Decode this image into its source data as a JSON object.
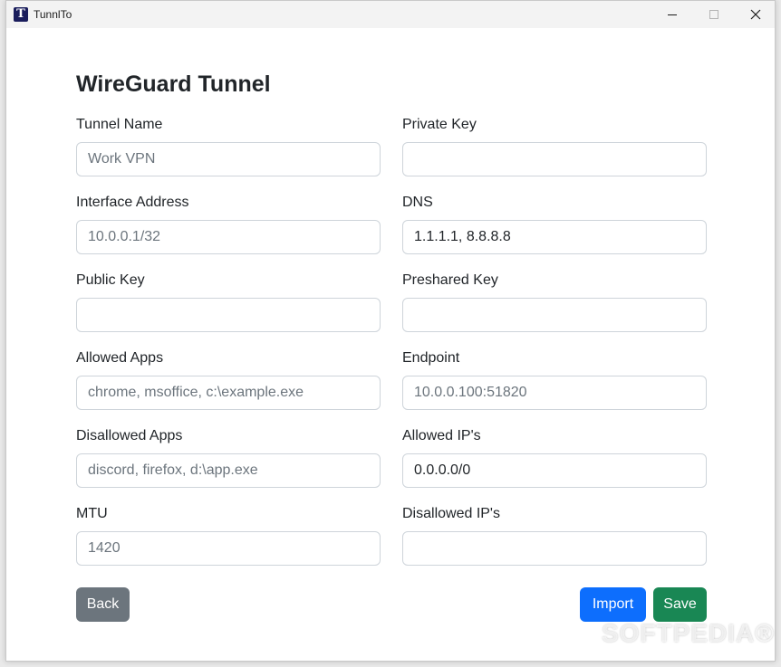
{
  "window": {
    "title": "TunnlTo",
    "icon_letter": "T"
  },
  "form": {
    "heading": "WireGuard Tunnel",
    "fields": {
      "tunnel_name": {
        "label": "Tunnel Name",
        "placeholder": "Work VPN",
        "value": ""
      },
      "private_key": {
        "label": "Private Key",
        "placeholder": "",
        "value": ""
      },
      "interface_address": {
        "label": "Interface Address",
        "placeholder": "10.0.0.1/32",
        "value": ""
      },
      "dns": {
        "label": "DNS",
        "placeholder": "",
        "value": "1.1.1.1, 8.8.8.8"
      },
      "public_key": {
        "label": "Public Key",
        "placeholder": "",
        "value": ""
      },
      "preshared_key": {
        "label": "Preshared Key",
        "placeholder": "",
        "value": ""
      },
      "allowed_apps": {
        "label": "Allowed Apps",
        "placeholder": "chrome, msoffice, c:\\example.exe",
        "value": ""
      },
      "endpoint": {
        "label": "Endpoint",
        "placeholder": "10.0.0.100:51820",
        "value": ""
      },
      "disallowed_apps": {
        "label": "Disallowed Apps",
        "placeholder": "discord, firefox, d:\\app.exe",
        "value": ""
      },
      "allowed_ips": {
        "label": "Allowed IP's",
        "placeholder": "",
        "value": "0.0.0.0/0"
      },
      "mtu": {
        "label": "MTU",
        "placeholder": "1420",
        "value": ""
      },
      "disallowed_ips": {
        "label": "Disallowed IP's",
        "placeholder": "",
        "value": ""
      }
    },
    "buttons": {
      "back": "Back",
      "import": "Import",
      "save": "Save"
    }
  },
  "watermark": "SOFTPEDIA®"
}
